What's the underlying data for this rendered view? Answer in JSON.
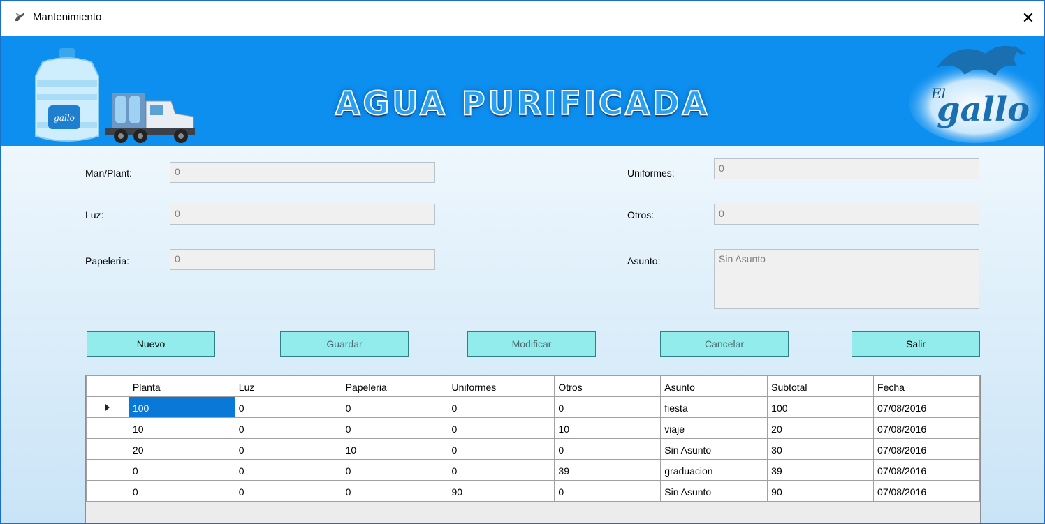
{
  "window": {
    "title": "Mantenimiento",
    "close_glyph": "✕"
  },
  "banner": {
    "headline": "AGUA PURIFICADA",
    "logo_text_top": "El",
    "logo_text_main": "gallo",
    "bottle_logo_text": "gallo"
  },
  "form": {
    "man_plant": {
      "label": "Man/Plant:",
      "value": "0"
    },
    "luz": {
      "label": "Luz:",
      "value": "0"
    },
    "papeleria": {
      "label": "Papeleria:",
      "value": "0"
    },
    "uniformes": {
      "label": "Uniformes:",
      "value": "0"
    },
    "otros": {
      "label": "Otros:",
      "value": "0"
    },
    "asunto": {
      "label": "Asunto:",
      "value": "Sin Asunto"
    }
  },
  "buttons": {
    "nuevo": "Nuevo",
    "guardar": "Guardar",
    "modificar": "Modificar",
    "cancelar": "Cancelar",
    "salir": "Salir"
  },
  "table": {
    "headers": [
      "Planta",
      "Luz",
      "Papeleria",
      "Uniformes",
      "Otros",
      "Asunto",
      "Subtotal",
      "Fecha"
    ],
    "rows": [
      [
        "100",
        "0",
        "0",
        "0",
        "0",
        "fiesta",
        "100",
        "07/08/2016"
      ],
      [
        "10",
        "0",
        "0",
        "0",
        "10",
        "viaje",
        "20",
        "07/08/2016"
      ],
      [
        "20",
        "0",
        "10",
        "0",
        "0",
        "Sin Asunto",
        "30",
        "07/08/2016"
      ],
      [
        "0",
        "0",
        "0",
        "0",
        "39",
        "graduacion",
        "39",
        "07/08/2016"
      ],
      [
        "0",
        "0",
        "0",
        "90",
        "0",
        "Sin Asunto",
        "90",
        "07/08/2016"
      ]
    ]
  },
  "colors": {
    "banner": "#0d8ff0",
    "button": "#92ecec",
    "selected_cell": "#0a78d7"
  },
  "icons": [
    "app-icon",
    "close-icon",
    "water-bottle-icon",
    "truck-icon",
    "rooster-logo-icon",
    "row-pointer-icon"
  ]
}
